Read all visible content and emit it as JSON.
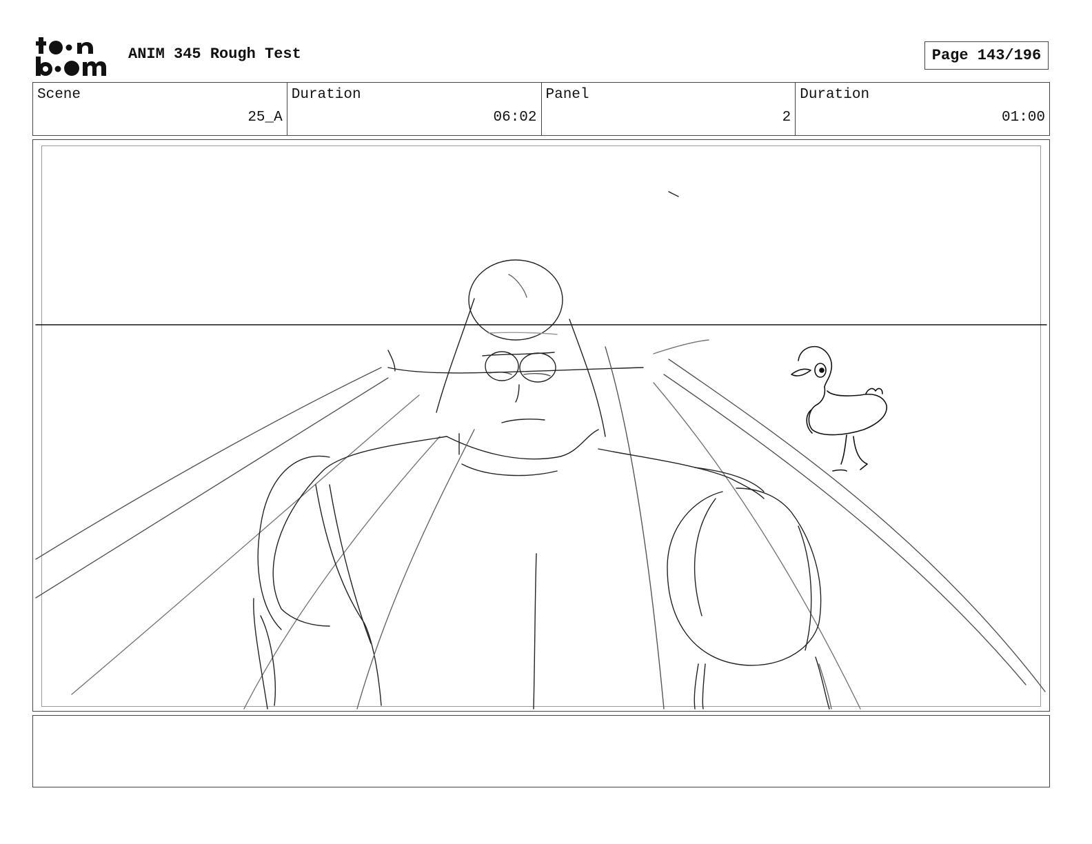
{
  "header": {
    "logo_text_line1": "toon",
    "logo_text_line2": "boom",
    "title": "ANIM 345 Rough Test",
    "page": "Page 143/196"
  },
  "info": {
    "scene_label": "Scene",
    "scene_value": "25_A",
    "scene_duration_label": "Duration",
    "scene_duration_value": "06:02",
    "panel_label": "Panel",
    "panel_value": "2",
    "panel_duration_label": "Duration",
    "panel_duration_value": "01:00"
  },
  "panel": {
    "image": "rough storyboard sketch: large muscular character with small head and glasses, horizon line, perspective lines, small bird on right"
  },
  "notes": {
    "text": ""
  }
}
